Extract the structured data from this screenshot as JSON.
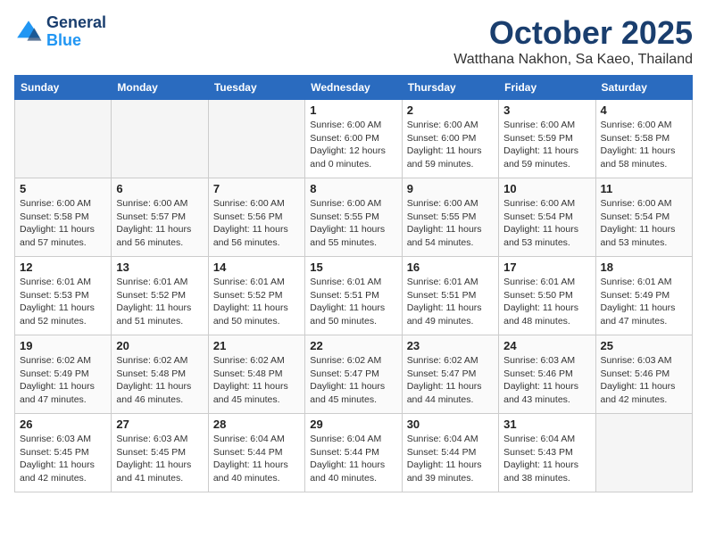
{
  "header": {
    "logo_line1": "General",
    "logo_line2": "Blue",
    "month_title": "October 2025",
    "location": "Watthana Nakhon, Sa Kaeo, Thailand"
  },
  "weekdays": [
    "Sunday",
    "Monday",
    "Tuesday",
    "Wednesday",
    "Thursday",
    "Friday",
    "Saturday"
  ],
  "weeks": [
    [
      {
        "day": "",
        "sunrise": "",
        "sunset": "",
        "daylight": "",
        "empty": true
      },
      {
        "day": "",
        "sunrise": "",
        "sunset": "",
        "daylight": "",
        "empty": true
      },
      {
        "day": "",
        "sunrise": "",
        "sunset": "",
        "daylight": "",
        "empty": true
      },
      {
        "day": "1",
        "sunrise": "Sunrise: 6:00 AM",
        "sunset": "Sunset: 6:00 PM",
        "daylight": "Daylight: 12 hours and 0 minutes.",
        "empty": false
      },
      {
        "day": "2",
        "sunrise": "Sunrise: 6:00 AM",
        "sunset": "Sunset: 6:00 PM",
        "daylight": "Daylight: 11 hours and 59 minutes.",
        "empty": false
      },
      {
        "day": "3",
        "sunrise": "Sunrise: 6:00 AM",
        "sunset": "Sunset: 5:59 PM",
        "daylight": "Daylight: 11 hours and 59 minutes.",
        "empty": false
      },
      {
        "day": "4",
        "sunrise": "Sunrise: 6:00 AM",
        "sunset": "Sunset: 5:58 PM",
        "daylight": "Daylight: 11 hours and 58 minutes.",
        "empty": false
      }
    ],
    [
      {
        "day": "5",
        "sunrise": "Sunrise: 6:00 AM",
        "sunset": "Sunset: 5:58 PM",
        "daylight": "Daylight: 11 hours and 57 minutes.",
        "empty": false
      },
      {
        "day": "6",
        "sunrise": "Sunrise: 6:00 AM",
        "sunset": "Sunset: 5:57 PM",
        "daylight": "Daylight: 11 hours and 56 minutes.",
        "empty": false
      },
      {
        "day": "7",
        "sunrise": "Sunrise: 6:00 AM",
        "sunset": "Sunset: 5:56 PM",
        "daylight": "Daylight: 11 hours and 56 minutes.",
        "empty": false
      },
      {
        "day": "8",
        "sunrise": "Sunrise: 6:00 AM",
        "sunset": "Sunset: 5:55 PM",
        "daylight": "Daylight: 11 hours and 55 minutes.",
        "empty": false
      },
      {
        "day": "9",
        "sunrise": "Sunrise: 6:00 AM",
        "sunset": "Sunset: 5:55 PM",
        "daylight": "Daylight: 11 hours and 54 minutes.",
        "empty": false
      },
      {
        "day": "10",
        "sunrise": "Sunrise: 6:00 AM",
        "sunset": "Sunset: 5:54 PM",
        "daylight": "Daylight: 11 hours and 53 minutes.",
        "empty": false
      },
      {
        "day": "11",
        "sunrise": "Sunrise: 6:00 AM",
        "sunset": "Sunset: 5:54 PM",
        "daylight": "Daylight: 11 hours and 53 minutes.",
        "empty": false
      }
    ],
    [
      {
        "day": "12",
        "sunrise": "Sunrise: 6:01 AM",
        "sunset": "Sunset: 5:53 PM",
        "daylight": "Daylight: 11 hours and 52 minutes.",
        "empty": false
      },
      {
        "day": "13",
        "sunrise": "Sunrise: 6:01 AM",
        "sunset": "Sunset: 5:52 PM",
        "daylight": "Daylight: 11 hours and 51 minutes.",
        "empty": false
      },
      {
        "day": "14",
        "sunrise": "Sunrise: 6:01 AM",
        "sunset": "Sunset: 5:52 PM",
        "daylight": "Daylight: 11 hours and 50 minutes.",
        "empty": false
      },
      {
        "day": "15",
        "sunrise": "Sunrise: 6:01 AM",
        "sunset": "Sunset: 5:51 PM",
        "daylight": "Daylight: 11 hours and 50 minutes.",
        "empty": false
      },
      {
        "day": "16",
        "sunrise": "Sunrise: 6:01 AM",
        "sunset": "Sunset: 5:51 PM",
        "daylight": "Daylight: 11 hours and 49 minutes.",
        "empty": false
      },
      {
        "day": "17",
        "sunrise": "Sunrise: 6:01 AM",
        "sunset": "Sunset: 5:50 PM",
        "daylight": "Daylight: 11 hours and 48 minutes.",
        "empty": false
      },
      {
        "day": "18",
        "sunrise": "Sunrise: 6:01 AM",
        "sunset": "Sunset: 5:49 PM",
        "daylight": "Daylight: 11 hours and 47 minutes.",
        "empty": false
      }
    ],
    [
      {
        "day": "19",
        "sunrise": "Sunrise: 6:02 AM",
        "sunset": "Sunset: 5:49 PM",
        "daylight": "Daylight: 11 hours and 47 minutes.",
        "empty": false
      },
      {
        "day": "20",
        "sunrise": "Sunrise: 6:02 AM",
        "sunset": "Sunset: 5:48 PM",
        "daylight": "Daylight: 11 hours and 46 minutes.",
        "empty": false
      },
      {
        "day": "21",
        "sunrise": "Sunrise: 6:02 AM",
        "sunset": "Sunset: 5:48 PM",
        "daylight": "Daylight: 11 hours and 45 minutes.",
        "empty": false
      },
      {
        "day": "22",
        "sunrise": "Sunrise: 6:02 AM",
        "sunset": "Sunset: 5:47 PM",
        "daylight": "Daylight: 11 hours and 45 minutes.",
        "empty": false
      },
      {
        "day": "23",
        "sunrise": "Sunrise: 6:02 AM",
        "sunset": "Sunset: 5:47 PM",
        "daylight": "Daylight: 11 hours and 44 minutes.",
        "empty": false
      },
      {
        "day": "24",
        "sunrise": "Sunrise: 6:03 AM",
        "sunset": "Sunset: 5:46 PM",
        "daylight": "Daylight: 11 hours and 43 minutes.",
        "empty": false
      },
      {
        "day": "25",
        "sunrise": "Sunrise: 6:03 AM",
        "sunset": "Sunset: 5:46 PM",
        "daylight": "Daylight: 11 hours and 42 minutes.",
        "empty": false
      }
    ],
    [
      {
        "day": "26",
        "sunrise": "Sunrise: 6:03 AM",
        "sunset": "Sunset: 5:45 PM",
        "daylight": "Daylight: 11 hours and 42 minutes.",
        "empty": false
      },
      {
        "day": "27",
        "sunrise": "Sunrise: 6:03 AM",
        "sunset": "Sunset: 5:45 PM",
        "daylight": "Daylight: 11 hours and 41 minutes.",
        "empty": false
      },
      {
        "day": "28",
        "sunrise": "Sunrise: 6:04 AM",
        "sunset": "Sunset: 5:44 PM",
        "daylight": "Daylight: 11 hours and 40 minutes.",
        "empty": false
      },
      {
        "day": "29",
        "sunrise": "Sunrise: 6:04 AM",
        "sunset": "Sunset: 5:44 PM",
        "daylight": "Daylight: 11 hours and 40 minutes.",
        "empty": false
      },
      {
        "day": "30",
        "sunrise": "Sunrise: 6:04 AM",
        "sunset": "Sunset: 5:44 PM",
        "daylight": "Daylight: 11 hours and 39 minutes.",
        "empty": false
      },
      {
        "day": "31",
        "sunrise": "Sunrise: 6:04 AM",
        "sunset": "Sunset: 5:43 PM",
        "daylight": "Daylight: 11 hours and 38 minutes.",
        "empty": false
      },
      {
        "day": "",
        "sunrise": "",
        "sunset": "",
        "daylight": "",
        "empty": true
      }
    ]
  ]
}
